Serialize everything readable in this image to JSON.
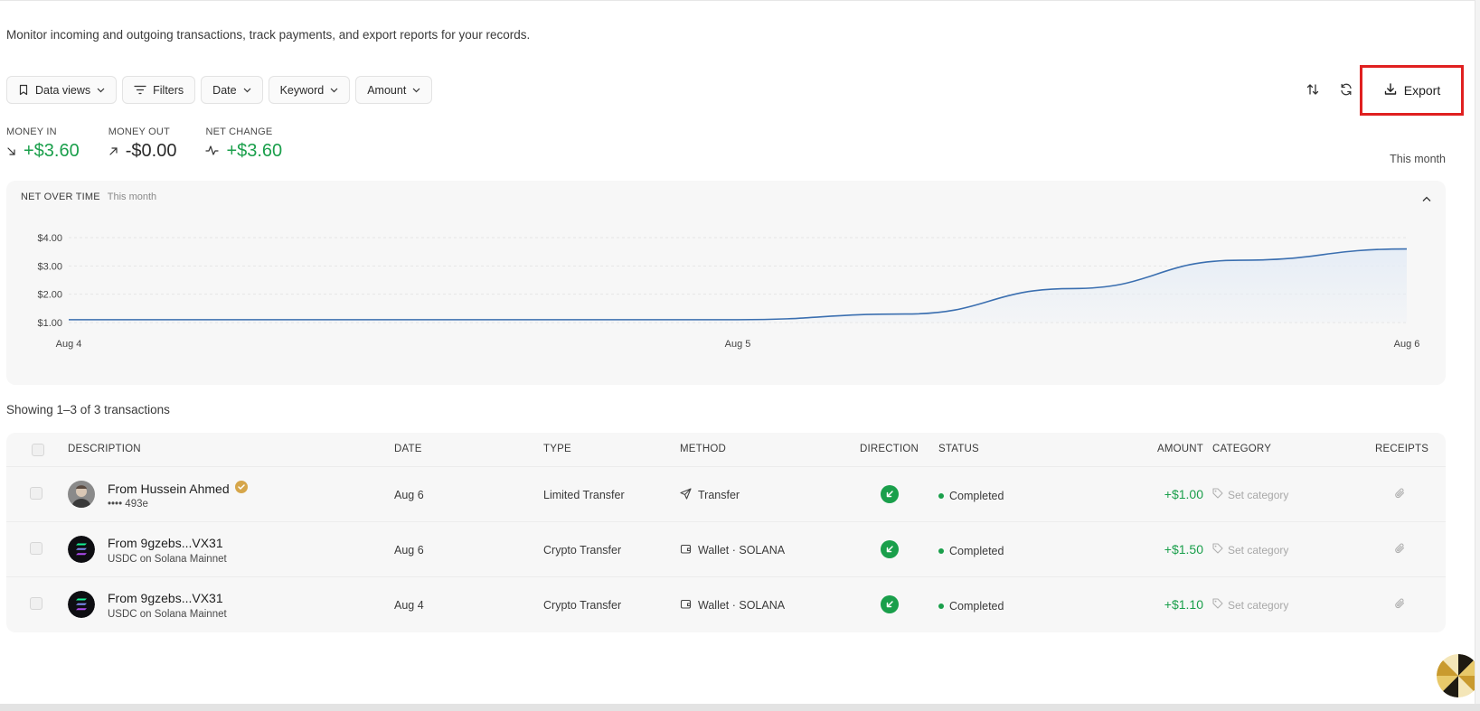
{
  "header": {
    "subtitle": "Monitor incoming and outgoing transactions, track payments, and export reports for your records."
  },
  "toolbar": {
    "data_views": "Data views",
    "filters": "Filters",
    "date": "Date",
    "keyword": "Keyword",
    "amount": "Amount",
    "export": "Export"
  },
  "stats": {
    "money_in_label": "MONEY IN",
    "money_in_value": "+$3.60",
    "money_out_label": "MONEY OUT",
    "money_out_value": "-$0.00",
    "net_change_label": "NET CHANGE",
    "net_change_value": "+$3.60",
    "period": "This month"
  },
  "chart": {
    "title": "NET OVER TIME",
    "period": "This month"
  },
  "chart_data": {
    "type": "area",
    "x": [
      "Aug 4",
      "Aug 4.5",
      "Aug 5",
      "Aug 5.25",
      "Aug 5.5",
      "Aug 5.75",
      "Aug 6"
    ],
    "x_ticks": [
      "Aug 4",
      "Aug 5",
      "Aug 6"
    ],
    "series": [
      {
        "values": [
          1.1,
          1.1,
          1.1,
          1.3,
          2.2,
          3.2,
          3.6
        ]
      }
    ],
    "y_ticks": [
      "$1.00",
      "$2.00",
      "$3.00",
      "$4.00"
    ],
    "ylim": [
      1.0,
      4.0
    ],
    "grid": true,
    "colors": {
      "line": "#3b6fb0",
      "fill": "#e6edf6"
    }
  },
  "table": {
    "showing": "Showing 1–3 of 3 transactions",
    "headers": {
      "description": "DESCRIPTION",
      "date": "DATE",
      "type": "TYPE",
      "method": "METHOD",
      "direction": "DIRECTION",
      "status": "STATUS",
      "amount": "AMOUNT",
      "category": "CATEGORY",
      "receipts": "RECEIPTS"
    },
    "rows": [
      {
        "title": "From Hussein Ahmed",
        "sub": "•••• 493e",
        "date": "Aug 6",
        "type": "Limited Transfer",
        "method": "Transfer",
        "status": "Completed",
        "amount": "+$1.00",
        "category": "Set category"
      },
      {
        "title": "From 9gzebs...VX31",
        "sub": "USDC on Solana Mainnet",
        "date": "Aug 6",
        "type": "Crypto Transfer",
        "method": "Wallet · SOLANA",
        "status": "Completed",
        "amount": "+$1.50",
        "category": "Set category"
      },
      {
        "title": "From 9gzebs...VX31",
        "sub": "USDC on Solana Mainnet",
        "date": "Aug 4",
        "type": "Crypto Transfer",
        "method": "Wallet · SOLANA",
        "status": "Completed",
        "amount": "+$1.10",
        "category": "Set category"
      }
    ]
  },
  "colors": {
    "accent_green": "#1a9f4b",
    "highlight_red": "#e02020"
  }
}
